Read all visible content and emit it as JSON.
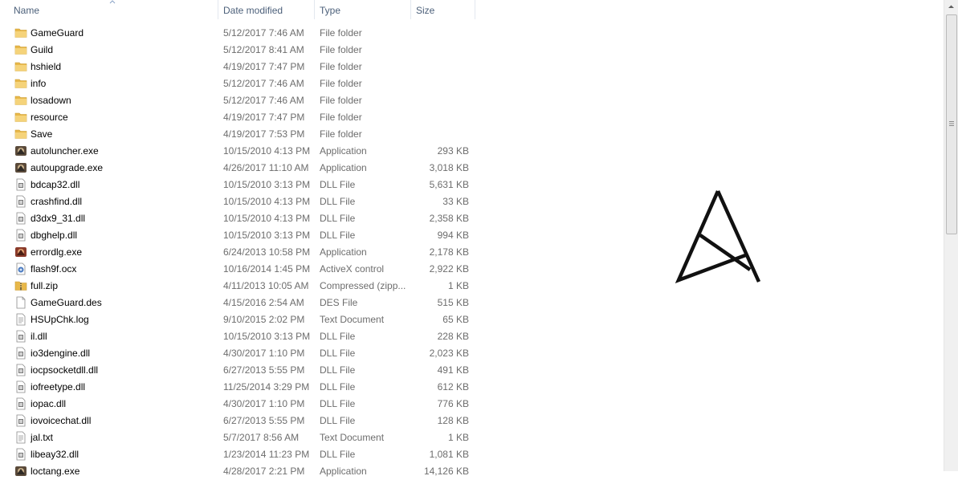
{
  "header": {
    "name": "Name",
    "date_modified": "Date modified",
    "type": "Type",
    "size": "Size"
  },
  "files": [
    {
      "name": "GameGuard",
      "date": "5/12/2017 7:46 AM",
      "type": "File folder",
      "size": "",
      "icon": "folder-icon"
    },
    {
      "name": "Guild",
      "date": "5/12/2017 8:41 AM",
      "type": "File folder",
      "size": "",
      "icon": "folder-icon"
    },
    {
      "name": "hshield",
      "date": "4/19/2017 7:47 PM",
      "type": "File folder",
      "size": "",
      "icon": "folder-icon"
    },
    {
      "name": "info",
      "date": "5/12/2017 7:46 AM",
      "type": "File folder",
      "size": "",
      "icon": "folder-icon"
    },
    {
      "name": "losadown",
      "date": "5/12/2017 7:46 AM",
      "type": "File folder",
      "size": "",
      "icon": "folder-icon"
    },
    {
      "name": "resource",
      "date": "4/19/2017 7:47 PM",
      "type": "File folder",
      "size": "",
      "icon": "folder-icon"
    },
    {
      "name": "Save",
      "date": "4/19/2017 7:53 PM",
      "type": "File folder",
      "size": "",
      "icon": "folder-icon"
    },
    {
      "name": "autoluncher.exe",
      "date": "10/15/2010 4:13 PM",
      "type": "Application",
      "size": "293 KB",
      "icon": "app-icon"
    },
    {
      "name": "autoupgrade.exe",
      "date": "4/26/2017 11:10 AM",
      "type": "Application",
      "size": "3,018 KB",
      "icon": "app-icon"
    },
    {
      "name": "bdcap32.dll",
      "date": "10/15/2010 3:13 PM",
      "type": "DLL File",
      "size": "5,631 KB",
      "icon": "dll-icon"
    },
    {
      "name": "crashfind.dll",
      "date": "10/15/2010 4:13 PM",
      "type": "DLL File",
      "size": "33 KB",
      "icon": "dll-icon"
    },
    {
      "name": "d3dx9_31.dll",
      "date": "10/15/2010 4:13 PM",
      "type": "DLL File",
      "size": "2,358 KB",
      "icon": "dll-icon"
    },
    {
      "name": "dbghelp.dll",
      "date": "10/15/2010 3:13 PM",
      "type": "DLL File",
      "size": "994 KB",
      "icon": "dll-icon"
    },
    {
      "name": "errordlg.exe",
      "date": "6/24/2013 10:58 PM",
      "type": "Application",
      "size": "2,178 KB",
      "icon": "error-app-icon"
    },
    {
      "name": "flash9f.ocx",
      "date": "10/16/2014 1:45 PM",
      "type": "ActiveX control",
      "size": "2,922 KB",
      "icon": "activex-icon"
    },
    {
      "name": "full.zip",
      "date": "4/11/2013 10:05 AM",
      "type": "Compressed (zipp...",
      "size": "1 KB",
      "icon": "zip-icon"
    },
    {
      "name": "GameGuard.des",
      "date": "4/15/2016 2:54 AM",
      "type": "DES File",
      "size": "515 KB",
      "icon": "blank-file-icon"
    },
    {
      "name": "HSUpChk.log",
      "date": "9/10/2015 2:02 PM",
      "type": "Text Document",
      "size": "65 KB",
      "icon": "text-file-icon"
    },
    {
      "name": "il.dll",
      "date": "10/15/2010 3:13 PM",
      "type": "DLL File",
      "size": "228 KB",
      "icon": "dll-icon"
    },
    {
      "name": "io3dengine.dll",
      "date": "4/30/2017 1:10 PM",
      "type": "DLL File",
      "size": "2,023 KB",
      "icon": "dll-icon"
    },
    {
      "name": "iocpsocketdll.dll",
      "date": "6/27/2013 5:55 PM",
      "type": "DLL File",
      "size": "491 KB",
      "icon": "dll-icon"
    },
    {
      "name": "iofreetype.dll",
      "date": "11/25/2014 3:29 PM",
      "type": "DLL File",
      "size": "612 KB",
      "icon": "dll-icon"
    },
    {
      "name": "iopac.dll",
      "date": "4/30/2017 1:10 PM",
      "type": "DLL File",
      "size": "776 KB",
      "icon": "dll-icon"
    },
    {
      "name": "iovoicechat.dll",
      "date": "6/27/2013 5:55 PM",
      "type": "DLL File",
      "size": "128 KB",
      "icon": "dll-icon"
    },
    {
      "name": "jal.txt",
      "date": "5/7/2017 8:56 AM",
      "type": "Text Document",
      "size": "1 KB",
      "icon": "text-file-icon"
    },
    {
      "name": "libeay32.dll",
      "date": "1/23/2014 11:23 PM",
      "type": "DLL File",
      "size": "1,081 KB",
      "icon": "dll-icon"
    },
    {
      "name": "loctang.exe",
      "date": "4/28/2017 2:21 PM",
      "type": "Application",
      "size": "14,126 KB",
      "icon": "app-icon"
    }
  ],
  "colors": {
    "folder": "#e8b84a",
    "header_text": "#4c607a",
    "secondary_text": "#6d6d6d"
  },
  "logo_icon": "triangle-logo-icon"
}
